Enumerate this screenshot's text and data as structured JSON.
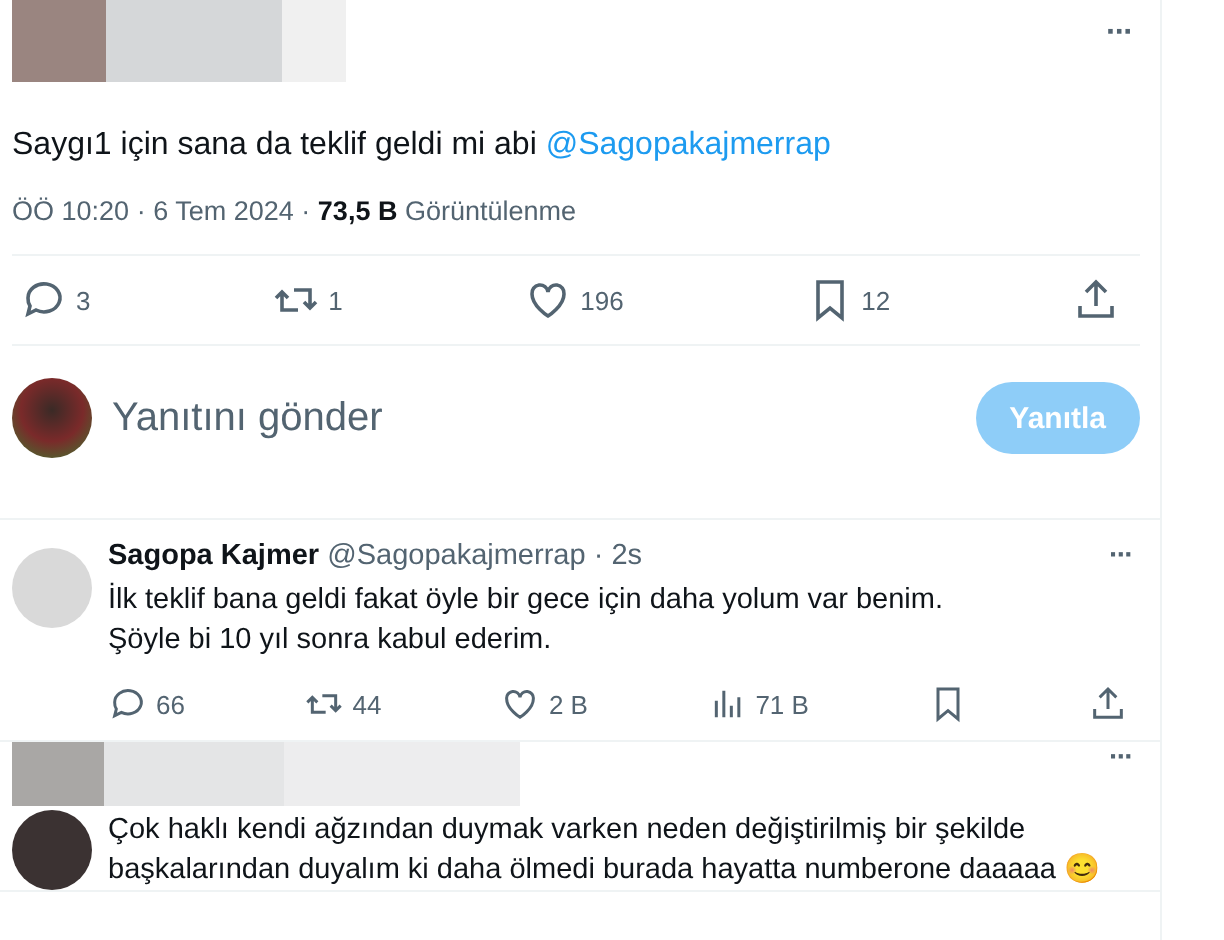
{
  "main_tweet": {
    "text": "Saygı1 için sana da teklif geldi mi abi",
    "mention": "@Sagopakajmerrap",
    "more": "···",
    "meta": {
      "time": "ÖÖ 10:20",
      "sep1": "·",
      "date": "6 Tem 2024",
      "sep2": "·",
      "views": "73,5 B",
      "views_label": "Görüntülenme"
    },
    "actions": [
      {
        "kind": "reply",
        "count": "3"
      },
      {
        "kind": "repost",
        "count": "1"
      },
      {
        "kind": "like",
        "count": "196"
      },
      {
        "kind": "bookmark",
        "count": "12"
      },
      {
        "kind": "share"
      }
    ]
  },
  "composer": {
    "placeholder": "Yanıtını gönder",
    "button": "Yanıtla",
    "disabled": true
  },
  "replies": [
    {
      "name": "Sagopa Kajmer",
      "handle": "@Sagopakajmerrap",
      "sep": "·",
      "age": "2s",
      "more": "···",
      "kind": "named",
      "lines": [
        "İlk teklif bana geldi fakat öyle bir gece için daha yolum var benim.",
        "Şöyle bi 10 yıl sonra kabul ederim."
      ],
      "actions": [
        {
          "kind": "reply",
          "count": "66"
        },
        {
          "kind": "repost",
          "count": "44"
        },
        {
          "kind": "like",
          "count": "2 B"
        },
        {
          "kind": "views",
          "count": "71 B"
        },
        {
          "kind": "bookmark"
        },
        {
          "kind": "share"
        }
      ]
    },
    {
      "kind": "hidden",
      "more": "···",
      "lines": [
        "Çok haklı kendi ağzından duymak varken neden değiştirilmiş bir şekilde",
        "başkalarından duyalım ki daha ölmedi burada hayatta numberone daaaaa 😊"
      ]
    }
  ]
}
